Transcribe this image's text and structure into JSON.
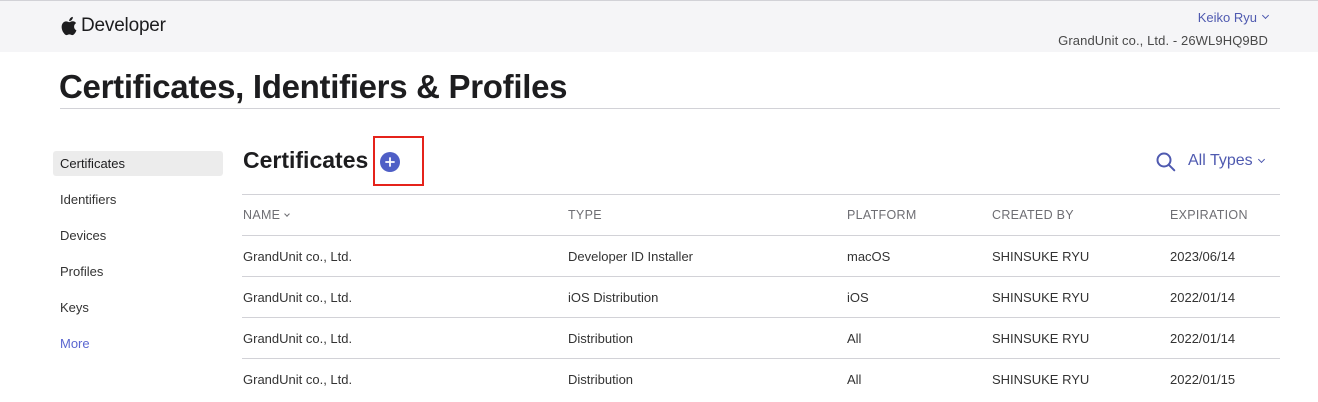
{
  "brand": {
    "name": "Developer"
  },
  "account": {
    "user_name": "Keiko Ryu",
    "team": "GrandUnit co., Ltd. - 26WL9HQ9BD"
  },
  "page": {
    "title": "Certificates, Identifiers & Profiles"
  },
  "sidebar": {
    "items": [
      {
        "label": "Certificates"
      },
      {
        "label": "Identifiers"
      },
      {
        "label": "Devices"
      },
      {
        "label": "Profiles"
      },
      {
        "label": "Keys"
      },
      {
        "label": "More"
      }
    ],
    "active": "Certificates"
  },
  "main": {
    "section_title": "Certificates",
    "add_icon": "plus-circle-icon",
    "search_icon": "search-icon",
    "type_filter": "All Types"
  },
  "table": {
    "columns": [
      "NAME",
      "TYPE",
      "PLATFORM",
      "CREATED BY",
      "EXPIRATION"
    ],
    "rows": [
      {
        "name": "GrandUnit co., Ltd.",
        "type": "Developer ID Installer",
        "platform": "macOS",
        "created_by": "SHINSUKE RYU",
        "expiration": "2023/06/14"
      },
      {
        "name": "GrandUnit co., Ltd.",
        "type": "iOS Distribution",
        "platform": "iOS",
        "created_by": "SHINSUKE RYU",
        "expiration": "2022/01/14"
      },
      {
        "name": "GrandUnit co., Ltd.",
        "type": "Distribution",
        "platform": "All",
        "created_by": "SHINSUKE RYU",
        "expiration": "2022/01/14"
      },
      {
        "name": "GrandUnit co., Ltd.",
        "type": "Distribution",
        "platform": "All",
        "created_by": "SHINSUKE RYU",
        "expiration": "2022/01/15"
      }
    ]
  },
  "colors": {
    "accent": "#4f5ab0",
    "add_button": "#4f5fc6",
    "highlight": "#e5231b",
    "topbar": "#f5f5f7"
  }
}
